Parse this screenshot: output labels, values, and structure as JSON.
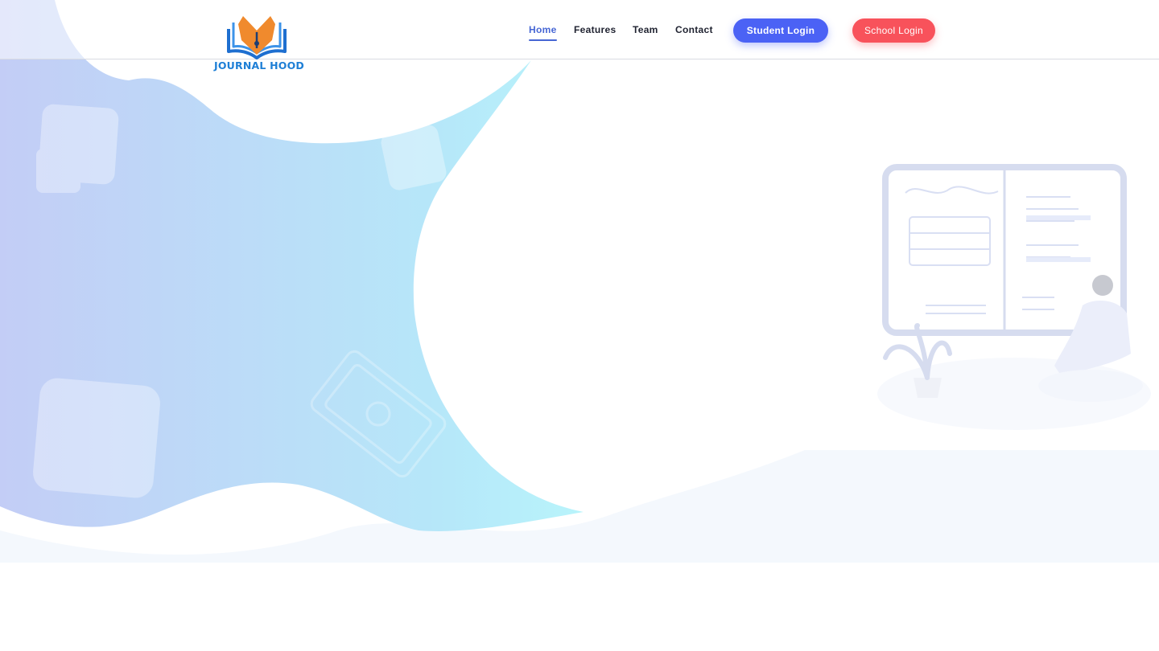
{
  "brand": {
    "name": "JOURNAL HOOD",
    "logo_colors": {
      "book": "#1e6fd0",
      "pen": "#f08a2d"
    }
  },
  "nav": {
    "links": [
      {
        "label": "Home",
        "active": true
      },
      {
        "label": "Features",
        "active": false
      },
      {
        "label": "Team",
        "active": false
      },
      {
        "label": "Contact",
        "active": false
      }
    ],
    "student_login_label": "Student Login",
    "school_login_label": "School Login"
  },
  "colors": {
    "accent": "#4666d4",
    "student_button": "#4b62f5",
    "school_button": "#f8525b",
    "hero_gradient_start": "#c3cdf6",
    "hero_gradient_end": "#b8f1fb"
  },
  "illustration": {
    "icon": "journal-book-illustration"
  }
}
